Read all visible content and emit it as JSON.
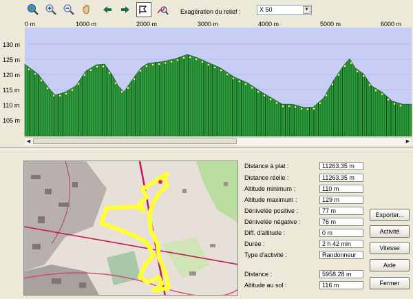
{
  "toolbar": {
    "icons": [
      "zoom-globe-icon",
      "zoom-in-icon",
      "zoom-out-icon",
      "pan-hand-icon",
      "arrow-left-icon",
      "arrow-right-icon",
      "profile-select-icon",
      "profile-search-icon"
    ],
    "exaggeration_label": "Exagération du relief :",
    "exaggeration_value": "X 50"
  },
  "profile": {
    "x_ticks": [
      "0 m",
      "1000 m",
      "2000 m",
      "3000 m",
      "4000 m",
      "5000 m",
      "6000 m"
    ],
    "y_ticks": [
      "130 m",
      "125 m",
      "120 m",
      "115 m",
      "110 m",
      "105 m"
    ],
    "fill_color": "#2a9a3a",
    "sky_color": "#c7cdf4",
    "point_color": "#ffff66"
  },
  "stats": [
    {
      "label": "Distance à plat :",
      "value": "11263.35 m"
    },
    {
      "label": "Distance réelle :",
      "value": "11263.35 m"
    },
    {
      "label": "Altitude minimum :",
      "value": "110 m"
    },
    {
      "label": "Altitude maximum :",
      "value": "129 m"
    },
    {
      "label": "Dénivelée positive :",
      "value": "77 m"
    },
    {
      "label": "Dénivelée négative :",
      "value": "76 m"
    },
    {
      "label": "Diff. d'altitude :",
      "value": "0 m"
    },
    {
      "label": "Durée :",
      "value": "2 h 42 min"
    },
    {
      "label": "Type d'activité :",
      "value": "Randonneur"
    },
    {
      "label": "Distance :",
      "value": "5958.28 m"
    },
    {
      "label": "Altitude au sol :",
      "value": "116 m"
    }
  ],
  "buttons": {
    "export": "Exporter...",
    "activity": "Activité",
    "speed": "Vitesse",
    "help": "Aide",
    "close": "Fermer"
  }
}
